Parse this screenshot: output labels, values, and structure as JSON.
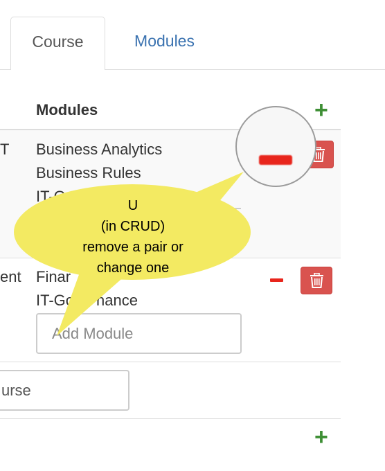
{
  "tabs": [
    {
      "label": "Course",
      "active": true
    },
    {
      "label": "Modules",
      "active": false
    }
  ],
  "table": {
    "header_modules": "Modules",
    "rows": [
      {
        "course_fragment": "T",
        "modules": [
          "Business Analytics",
          "Business Rules",
          "IT-Go"
        ]
      },
      {
        "course_fragment": "ent",
        "modules": [
          "Finar",
          "IT-Go"
        ],
        "modules_right": [
          "",
          "nance"
        ],
        "add_module_placeholder": "Add Module"
      }
    ],
    "new_course_input_value": "urse"
  },
  "annotation": {
    "lines": [
      "U",
      "(in CRUD)",
      "remove a pair or",
      "change one"
    ]
  },
  "colors": {
    "accent_link": "#3a72b0",
    "add_green": "#3e8f35",
    "delete_red": "#d9534f",
    "minus_red": "#e8251c",
    "bubble_yellow": "#f3ea62"
  },
  "icons": [
    "plus-icon",
    "minus-icon",
    "trash-icon"
  ]
}
